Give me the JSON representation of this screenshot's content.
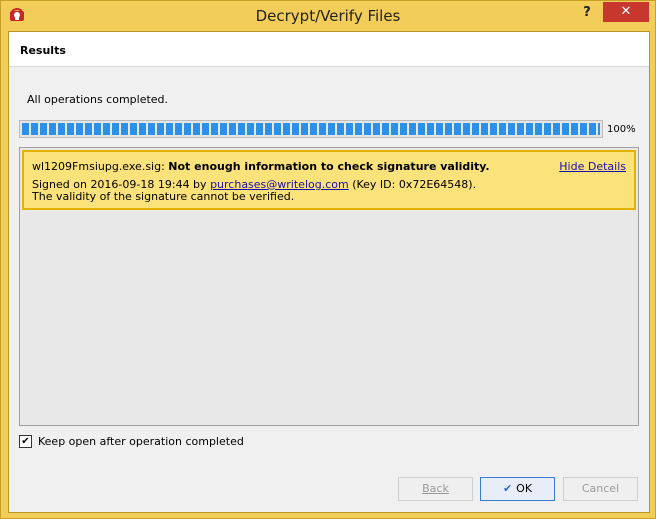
{
  "window": {
    "title": "Decrypt/Verify Files",
    "help_glyph": "?",
    "close_glyph": "✕",
    "app_icon": "kleopatra-app-icon"
  },
  "header": {
    "title": "Results"
  },
  "status": {
    "text": "All operations completed."
  },
  "progress": {
    "value_percent": 100,
    "label": "100%"
  },
  "result": {
    "filename": "wl1209Fmsiupg.exe.sig:",
    "summary": "Not enough information to check signature validity.",
    "hide_details": "Hide Details",
    "signed_prefix": "Signed on 2016-09-18 19:44 by",
    "signer_email": "purchases@writelog.com",
    "key_id": "(Key ID: 0x72E64548).",
    "validity_note": "The validity of the signature cannot be verified.",
    "colors": {
      "background": "#fbe27a",
      "border": "#e0b400"
    }
  },
  "options": {
    "keep_open_label": "Keep open after operation completed",
    "keep_open_checked": true,
    "check_glyph": "✔"
  },
  "buttons": {
    "back": "Back",
    "ok": "OK",
    "ok_icon": "checkmark-icon",
    "ok_glyph": "✔",
    "cancel": "Cancel"
  }
}
